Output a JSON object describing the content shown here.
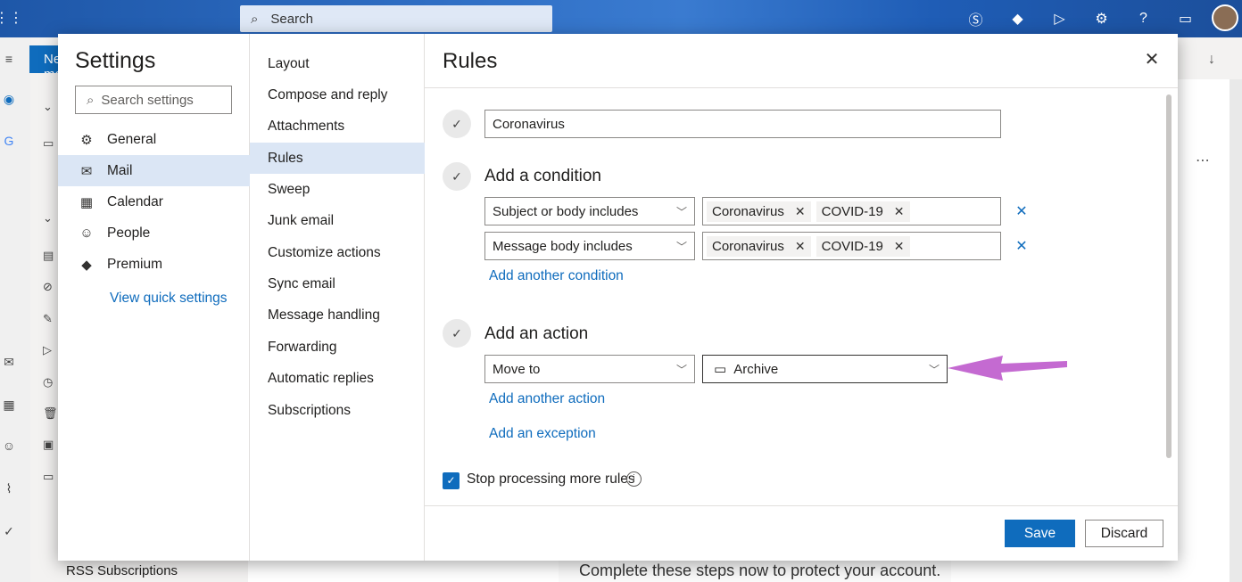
{
  "background": {
    "search_placeholder": "Search",
    "new_button_label": "New message",
    "folder_last": "RSS Subscriptions",
    "reading_text": "Complete these steps now to protect your account.",
    "top_icons": [
      "skype-icon",
      "premium-icon",
      "send-icon",
      "gear-icon",
      "help-icon",
      "feedback-icon"
    ]
  },
  "settings": {
    "title": "Settings",
    "search_placeholder": "Search settings",
    "categories": [
      {
        "label": "General",
        "icon": "gear-icon"
      },
      {
        "label": "Mail",
        "icon": "mail-icon"
      },
      {
        "label": "Calendar",
        "icon": "calendar-icon"
      },
      {
        "label": "People",
        "icon": "people-icon"
      },
      {
        "label": "Premium",
        "icon": "diamond-icon"
      }
    ],
    "quick_settings_link": "View quick settings",
    "mail_sections": [
      "Layout",
      "Compose and reply",
      "Attachments",
      "Rules",
      "Sweep",
      "Junk email",
      "Customize actions",
      "Sync email",
      "Message handling",
      "Forwarding",
      "Automatic replies",
      "Subscriptions"
    ]
  },
  "rules": {
    "title": "Rules",
    "rule_name": "Coronavirus",
    "condition_title": "Add a condition",
    "conditions": [
      {
        "field": "Subject or body includes",
        "chips": [
          "Coronavirus",
          "COVID-19"
        ]
      },
      {
        "field": "Message body includes",
        "chips": [
          "Coronavirus",
          "COVID-19"
        ]
      }
    ],
    "add_condition": "Add another condition",
    "action_title": "Add an action",
    "action_type": "Move to",
    "action_folder": "Archive",
    "add_action": "Add another action",
    "add_exception": "Add an exception",
    "stop_processing": "Stop processing more rules",
    "save": "Save",
    "discard": "Discard"
  },
  "colors": {
    "accent": "#0f6cbd",
    "selected_bg": "#dbe6f5",
    "annotation_arrow": "#c46ad1"
  }
}
